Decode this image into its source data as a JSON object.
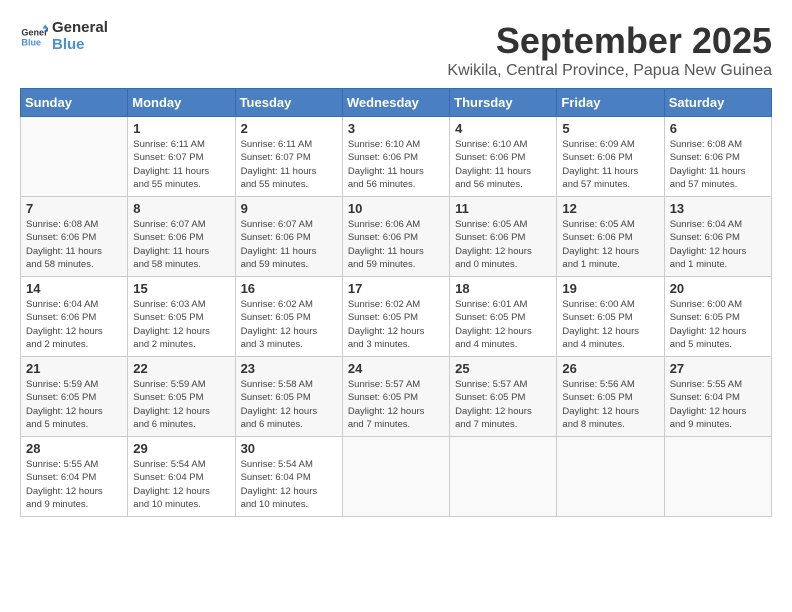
{
  "logo": {
    "line1": "General",
    "line2": "Blue"
  },
  "title": "September 2025",
  "subtitle": "Kwikila, Central Province, Papua New Guinea",
  "days_header": [
    "Sunday",
    "Monday",
    "Tuesday",
    "Wednesday",
    "Thursday",
    "Friday",
    "Saturday"
  ],
  "weeks": [
    [
      {
        "day": "",
        "info": ""
      },
      {
        "day": "1",
        "info": "Sunrise: 6:11 AM\nSunset: 6:07 PM\nDaylight: 11 hours\nand 55 minutes."
      },
      {
        "day": "2",
        "info": "Sunrise: 6:11 AM\nSunset: 6:07 PM\nDaylight: 11 hours\nand 55 minutes."
      },
      {
        "day": "3",
        "info": "Sunrise: 6:10 AM\nSunset: 6:06 PM\nDaylight: 11 hours\nand 56 minutes."
      },
      {
        "day": "4",
        "info": "Sunrise: 6:10 AM\nSunset: 6:06 PM\nDaylight: 11 hours\nand 56 minutes."
      },
      {
        "day": "5",
        "info": "Sunrise: 6:09 AM\nSunset: 6:06 PM\nDaylight: 11 hours\nand 57 minutes."
      },
      {
        "day": "6",
        "info": "Sunrise: 6:08 AM\nSunset: 6:06 PM\nDaylight: 11 hours\nand 57 minutes."
      }
    ],
    [
      {
        "day": "7",
        "info": "Sunrise: 6:08 AM\nSunset: 6:06 PM\nDaylight: 11 hours\nand 58 minutes."
      },
      {
        "day": "8",
        "info": "Sunrise: 6:07 AM\nSunset: 6:06 PM\nDaylight: 11 hours\nand 58 minutes."
      },
      {
        "day": "9",
        "info": "Sunrise: 6:07 AM\nSunset: 6:06 PM\nDaylight: 11 hours\nand 59 minutes."
      },
      {
        "day": "10",
        "info": "Sunrise: 6:06 AM\nSunset: 6:06 PM\nDaylight: 11 hours\nand 59 minutes."
      },
      {
        "day": "11",
        "info": "Sunrise: 6:05 AM\nSunset: 6:06 PM\nDaylight: 12 hours\nand 0 minutes."
      },
      {
        "day": "12",
        "info": "Sunrise: 6:05 AM\nSunset: 6:06 PM\nDaylight: 12 hours\nand 1 minute."
      },
      {
        "day": "13",
        "info": "Sunrise: 6:04 AM\nSunset: 6:06 PM\nDaylight: 12 hours\nand 1 minute."
      }
    ],
    [
      {
        "day": "14",
        "info": "Sunrise: 6:04 AM\nSunset: 6:06 PM\nDaylight: 12 hours\nand 2 minutes."
      },
      {
        "day": "15",
        "info": "Sunrise: 6:03 AM\nSunset: 6:05 PM\nDaylight: 12 hours\nand 2 minutes."
      },
      {
        "day": "16",
        "info": "Sunrise: 6:02 AM\nSunset: 6:05 PM\nDaylight: 12 hours\nand 3 minutes."
      },
      {
        "day": "17",
        "info": "Sunrise: 6:02 AM\nSunset: 6:05 PM\nDaylight: 12 hours\nand 3 minutes."
      },
      {
        "day": "18",
        "info": "Sunrise: 6:01 AM\nSunset: 6:05 PM\nDaylight: 12 hours\nand 4 minutes."
      },
      {
        "day": "19",
        "info": "Sunrise: 6:00 AM\nSunset: 6:05 PM\nDaylight: 12 hours\nand 4 minutes."
      },
      {
        "day": "20",
        "info": "Sunrise: 6:00 AM\nSunset: 6:05 PM\nDaylight: 12 hours\nand 5 minutes."
      }
    ],
    [
      {
        "day": "21",
        "info": "Sunrise: 5:59 AM\nSunset: 6:05 PM\nDaylight: 12 hours\nand 5 minutes."
      },
      {
        "day": "22",
        "info": "Sunrise: 5:59 AM\nSunset: 6:05 PM\nDaylight: 12 hours\nand 6 minutes."
      },
      {
        "day": "23",
        "info": "Sunrise: 5:58 AM\nSunset: 6:05 PM\nDaylight: 12 hours\nand 6 minutes."
      },
      {
        "day": "24",
        "info": "Sunrise: 5:57 AM\nSunset: 6:05 PM\nDaylight: 12 hours\nand 7 minutes."
      },
      {
        "day": "25",
        "info": "Sunrise: 5:57 AM\nSunset: 6:05 PM\nDaylight: 12 hours\nand 7 minutes."
      },
      {
        "day": "26",
        "info": "Sunrise: 5:56 AM\nSunset: 6:05 PM\nDaylight: 12 hours\nand 8 minutes."
      },
      {
        "day": "27",
        "info": "Sunrise: 5:55 AM\nSunset: 6:04 PM\nDaylight: 12 hours\nand 9 minutes."
      }
    ],
    [
      {
        "day": "28",
        "info": "Sunrise: 5:55 AM\nSunset: 6:04 PM\nDaylight: 12 hours\nand 9 minutes."
      },
      {
        "day": "29",
        "info": "Sunrise: 5:54 AM\nSunset: 6:04 PM\nDaylight: 12 hours\nand 10 minutes."
      },
      {
        "day": "30",
        "info": "Sunrise: 5:54 AM\nSunset: 6:04 PM\nDaylight: 12 hours\nand 10 minutes."
      },
      {
        "day": "",
        "info": ""
      },
      {
        "day": "",
        "info": ""
      },
      {
        "day": "",
        "info": ""
      },
      {
        "day": "",
        "info": ""
      }
    ]
  ]
}
